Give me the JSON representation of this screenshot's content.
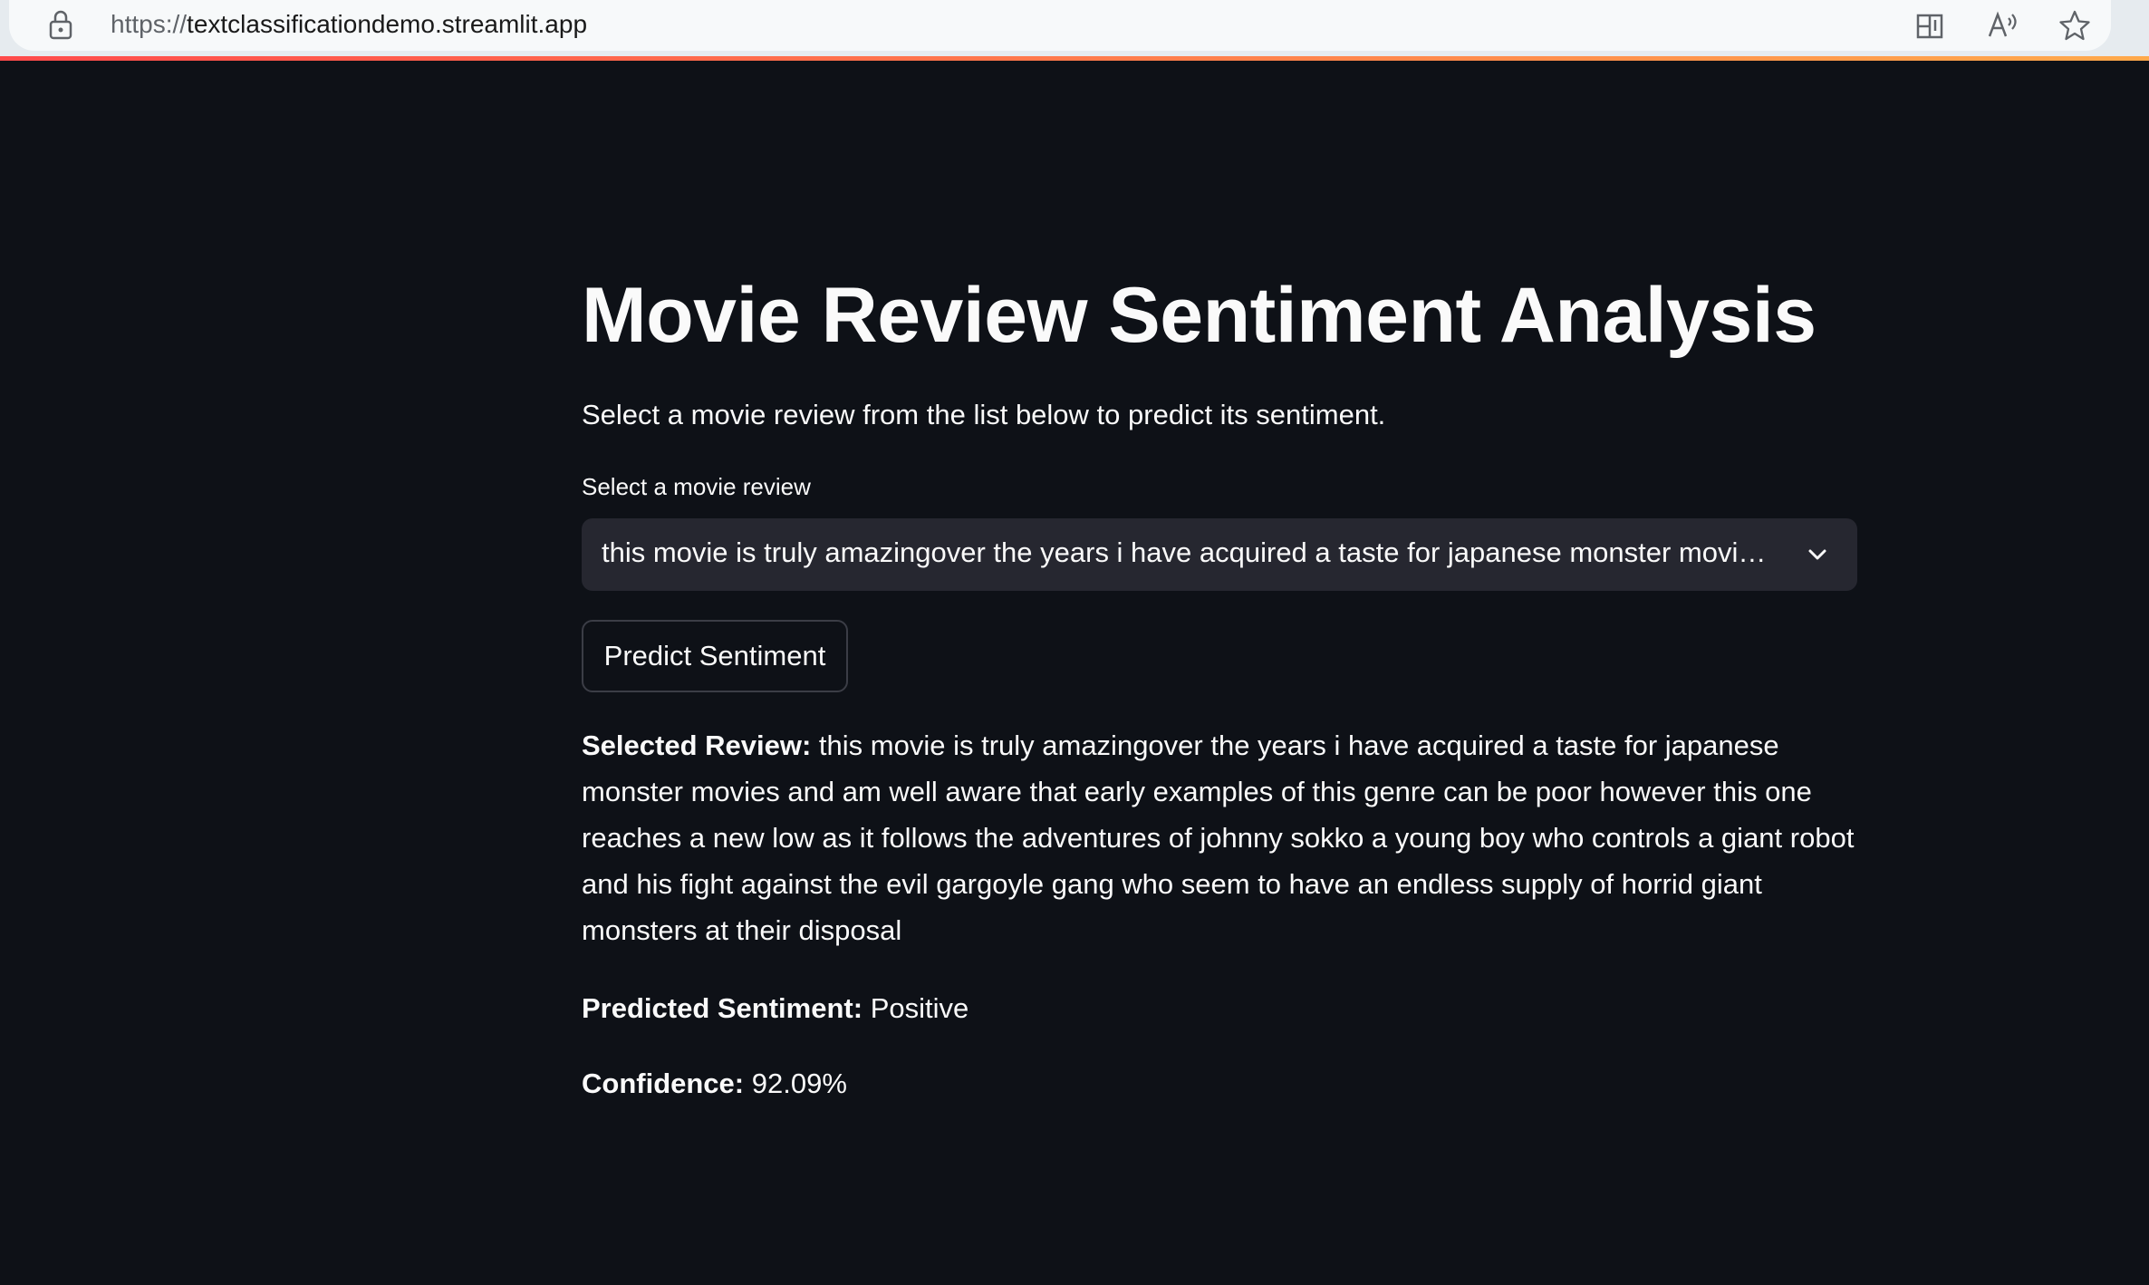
{
  "browser": {
    "url_scheme": "https://",
    "url_host": "textclassificationdemo.streamlit.app",
    "icons": [
      "lock-icon",
      "split-screen-icon",
      "read-aloud-icon",
      "favorite-star-icon"
    ]
  },
  "colors": {
    "background": "#0e1117",
    "select_background": "#262730",
    "text": "#fafafa",
    "accent_line_start": "#ff4b4b",
    "accent_line_end": "#ffa94b"
  },
  "app": {
    "title": "Movie Review Sentiment Analysis",
    "subtitle": "Select a movie review from the list below to predict its sentiment.",
    "select_label": "Select a movie review",
    "select_value": "this movie is truly amazingover the years i have acquired a taste for japanese monster movies and am well aware that early examples of this genre can be poor however this one reaches a new low as it follows the adventures of johnny sokko a young boy who controls a giant robot and his fight against the evil gargoyle gang who seem to have an endless supply of horrid giant monsters at their disposal",
    "predict_button": "Predict Sentiment",
    "selected_review_label": "Selected Review:",
    "selected_review_text": "this movie is truly amazingover the years i have acquired a taste for japanese monster movies and am well aware that early examples of this genre can be poor however this one reaches a new low as it follows the adventures of johnny sokko a young boy who controls a giant robot and his fight against the evil gargoyle gang who seem to have an endless supply of horrid giant monsters at their disposal",
    "predicted_sentiment_label": "Predicted Sentiment:",
    "predicted_sentiment_value": "Positive",
    "confidence_label": "Confidence:",
    "confidence_value": "92.09%"
  }
}
